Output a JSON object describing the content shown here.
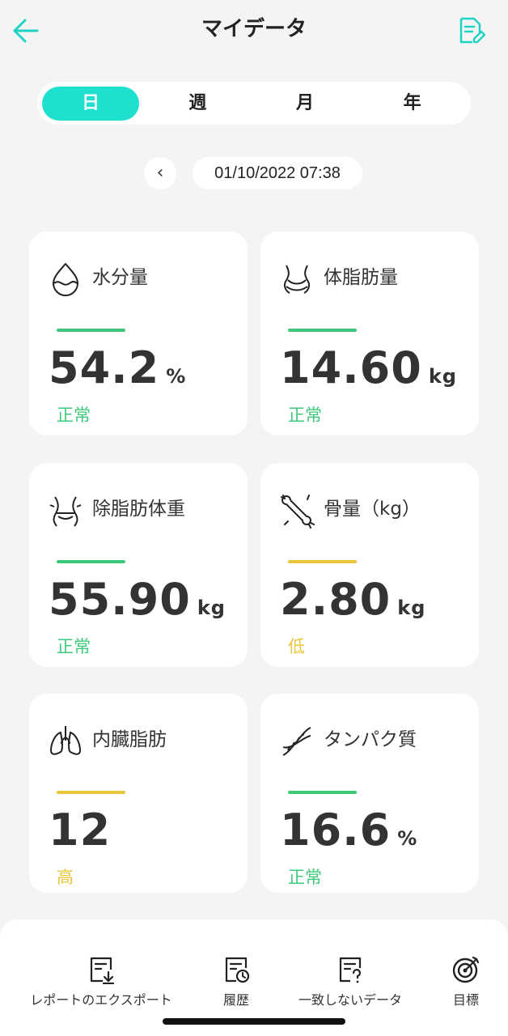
{
  "header": {
    "title": "マイデータ",
    "back_icon": "arrow-left-icon",
    "edit_icon": "document-edit-icon",
    "accent": "#1fd3c4"
  },
  "segments": {
    "items": [
      "日",
      "週",
      "月",
      "年"
    ],
    "active": "日",
    "active_color": "#1fe0cf"
  },
  "date": {
    "prev_label": "‹",
    "value": "01/10/2022 07:38"
  },
  "cards": [
    {
      "label": "水分量",
      "icon": "water-drop-icon",
      "value": "54.2",
      "unit": "%",
      "status": "正常",
      "status_color": "#3ec97a"
    },
    {
      "label": "体脂肪量",
      "icon": "body-fat-icon",
      "value": "14.60",
      "unit": "kg",
      "status": "正常",
      "status_color": "#3ec97a"
    },
    {
      "label": "除脂肪体重",
      "icon": "waist-icon",
      "value": "55.90",
      "unit": "kg",
      "status": "正常",
      "status_color": "#3ec97a"
    },
    {
      "label": "骨量（kg）",
      "icon": "bone-icon",
      "value": "2.80",
      "unit": "kg",
      "status": "低",
      "status_color": "#e8c53a"
    },
    {
      "label": "内臓脂肪",
      "icon": "lungs-icon",
      "value": "12",
      "unit": "",
      "status": "高",
      "status_color": "#e8c53a"
    },
    {
      "label": "タンパク質",
      "icon": "dna-icon",
      "value": "16.6",
      "unit": "%",
      "status": "正常",
      "status_color": "#3ec97a"
    }
  ],
  "bottom_tabs": [
    {
      "label": "レポートのエクスポート",
      "icon": "export-report-icon"
    },
    {
      "label": "履歴",
      "icon": "history-icon"
    },
    {
      "label": "一致しないデータ",
      "icon": "unmatched-data-icon"
    },
    {
      "label": "目標",
      "icon": "target-icon"
    }
  ]
}
